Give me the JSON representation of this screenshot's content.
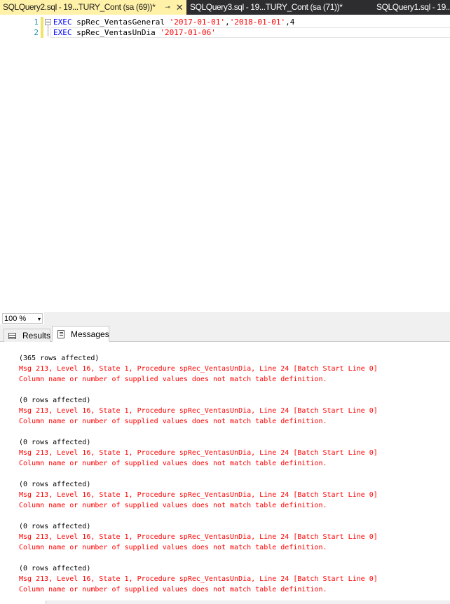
{
  "tabs": [
    {
      "label": "SQLQuery2.sql - 19...TURY_Cont (sa (69))*",
      "pin_icon": "pin-icon",
      "close_icon": "close-icon"
    },
    {
      "label": "SQLQuery3.sql - 19...TURY_Cont (sa (71))*"
    },
    {
      "label": "SQLQuery1.sql - 19..."
    }
  ],
  "tab_pin": "⊸",
  "tab_close": "✕",
  "editor": {
    "lines": [
      {
        "number": "1",
        "keyword": "EXEC",
        "proc": " spRec_VentasGeneral ",
        "str1": "'2017-01-01'",
        "sep": ",",
        "str2": "'2018-01-01'",
        "rest": ",4"
      },
      {
        "number": "2",
        "keyword": "EXEC",
        "proc": " spRec_VentasUnDia ",
        "str1": "'2017-01-06'"
      }
    ]
  },
  "zoom": {
    "value": "100 %",
    "arrow": "▾"
  },
  "result_tabs": {
    "results": "Results",
    "messages": "Messages"
  },
  "messages": [
    {
      "info": "(365 rows affected)",
      "err1": "Msg 213, Level 16, State 1, Procedure spRec_VentasUnDia, Line 24 [Batch Start Line 0]",
      "err2": "Column name or number of supplied values does not match table definition."
    },
    {
      "info": "(0 rows affected)",
      "err1": "Msg 213, Level 16, State 1, Procedure spRec_VentasUnDia, Line 24 [Batch Start Line 0]",
      "err2": "Column name or number of supplied values does not match table definition."
    },
    {
      "info": "(0 rows affected)",
      "err1": "Msg 213, Level 16, State 1, Procedure spRec_VentasUnDia, Line 24 [Batch Start Line 0]",
      "err2": "Column name or number of supplied values does not match table definition."
    },
    {
      "info": "(0 rows affected)",
      "err1": "Msg 213, Level 16, State 1, Procedure spRec_VentasUnDia, Line 24 [Batch Start Line 0]",
      "err2": "Column name or number of supplied values does not match table definition."
    },
    {
      "info": "(0 rows affected)",
      "err1": "Msg 213, Level 16, State 1, Procedure spRec_VentasUnDia, Line 24 [Batch Start Line 0]",
      "err2": "Column name or number of supplied values does not match table definition."
    },
    {
      "info": "(0 rows affected)",
      "err1": "Msg 213, Level 16, State 1, Procedure spRec_VentasUnDia, Line 24 [Batch Start Line 0]",
      "err2": "Column name or number of supplied values does not match table definition."
    }
  ],
  "colors": {
    "active_tab": "#fff1a8",
    "tab_bar": "#2d2d30",
    "keyword": "#0000ff",
    "string": "#ff0000",
    "error": "#ff0000",
    "line_number": "#2b91af"
  }
}
